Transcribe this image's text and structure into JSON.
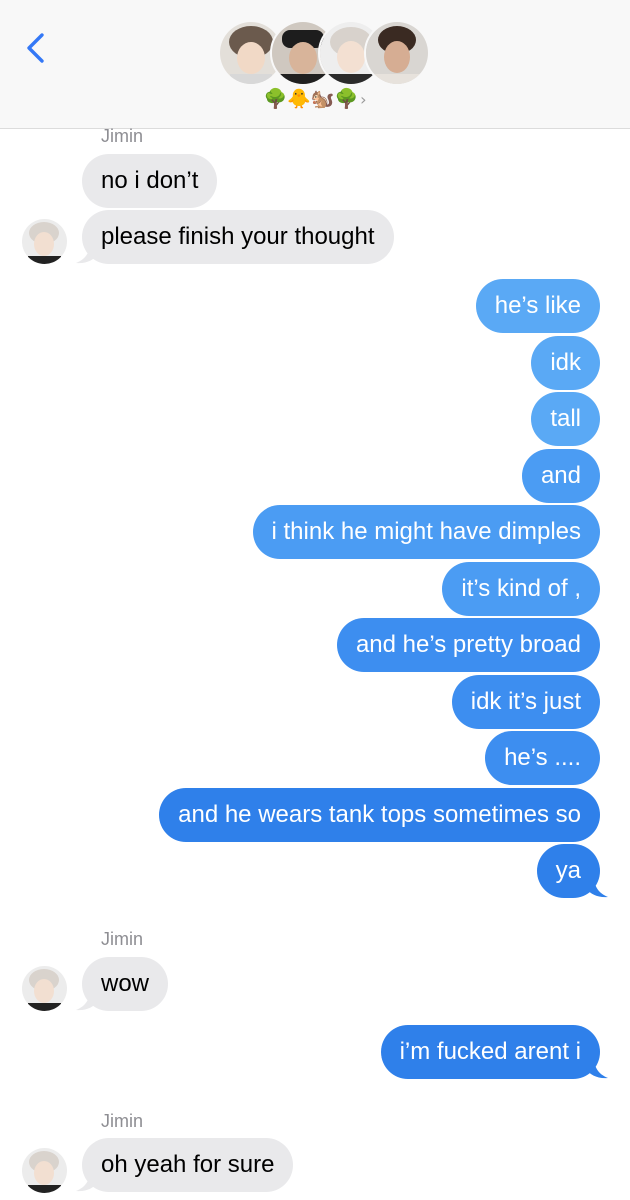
{
  "header": {
    "back_icon": "chevron-left-icon",
    "group_emoji": "🌳🐥🐿️🌳",
    "chevron": "›",
    "accent": "#3478f6"
  },
  "colors": {
    "incoming": "#e9e9eb",
    "outgoing": "#3d8ef0"
  },
  "messages": [
    {
      "sender": "Jimin",
      "text": "no i don’t",
      "direction": "in"
    },
    {
      "text": "please finish your thought",
      "direction": "in"
    },
    {
      "text": "he’s like",
      "direction": "out"
    },
    {
      "text": "idk",
      "direction": "out"
    },
    {
      "text": "tall",
      "direction": "out"
    },
    {
      "text": "and",
      "direction": "out"
    },
    {
      "text": "i think he might have dimples",
      "direction": "out"
    },
    {
      "text": "it’s kind of ,",
      "direction": "out"
    },
    {
      "text": "and he’s pretty broad",
      "direction": "out"
    },
    {
      "text": "idk it’s just",
      "direction": "out"
    },
    {
      "text": "he’s ....",
      "direction": "out"
    },
    {
      "text": "and he wears tank tops sometimes so",
      "direction": "out"
    },
    {
      "text": "ya",
      "direction": "out"
    },
    {
      "sender": "Jimin",
      "text": "wow",
      "direction": "in"
    },
    {
      "text": "i’m fucked arent i",
      "direction": "out"
    },
    {
      "sender": "Jimin",
      "text": "oh yeah for sure",
      "direction": "in"
    }
  ]
}
